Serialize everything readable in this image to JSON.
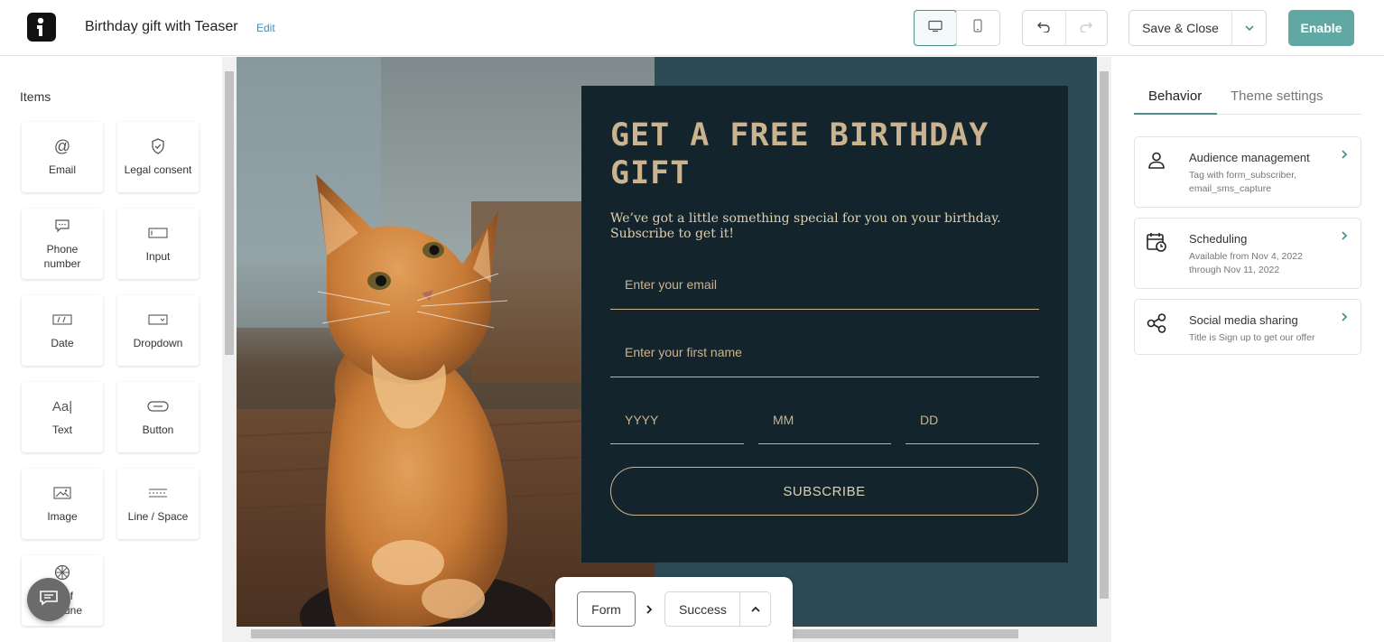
{
  "header": {
    "title": "Birthday gift with Teaser",
    "edit_label": "Edit",
    "save_label": "Save & Close",
    "enable_label": "Enable",
    "device_icons": [
      "desktop-icon",
      "mobile-icon"
    ],
    "history_icons": [
      "undo-icon",
      "redo-icon"
    ]
  },
  "left_panel": {
    "title": "Items",
    "items": [
      {
        "label": "Email",
        "icon": "at-icon"
      },
      {
        "label": "Legal consent",
        "icon": "shield-check-icon"
      },
      {
        "label": "Phone number",
        "icon": "chat-icon"
      },
      {
        "label": "Input",
        "icon": "input-icon"
      },
      {
        "label": "Date",
        "icon": "date-icon"
      },
      {
        "label": "Dropdown",
        "icon": "dropdown-icon"
      },
      {
        "label": "Text",
        "icon": "text-icon"
      },
      {
        "label": "Button",
        "icon": "button-icon"
      },
      {
        "label": "Image",
        "icon": "image-icon"
      },
      {
        "label": "Line / Space",
        "icon": "line-space-icon"
      },
      {
        "label_line1": "of",
        "label_line2": "une",
        "icon": "wheel-icon"
      }
    ]
  },
  "form": {
    "title": "GET A FREE BIRTHDAY GIFT",
    "subtitle": "We’ve got a little something special for you on your birthday. Subscribe to get it!",
    "email_placeholder": "Enter your email",
    "name_placeholder": "Enter your first name",
    "year_placeholder": "YYYY",
    "month_placeholder": "MM",
    "day_placeholder": "DD",
    "submit_label": "SUBSCRIBE"
  },
  "steps": {
    "form_label": "Form",
    "success_label": "Success"
  },
  "right_panel": {
    "tabs": [
      "Behavior",
      "Theme settings"
    ],
    "active_tab": "Behavior",
    "cards": [
      {
        "title": "Audience management",
        "desc_line1": "Tag with form_subscriber,",
        "desc_line2": "email_sms_capture",
        "icon": "person-icon"
      },
      {
        "title": "Scheduling",
        "desc_line1": "Available from Nov 4, 2022",
        "desc_line2": "through Nov 11, 2022",
        "icon": "calendar-clock-icon"
      },
      {
        "title": "Social media sharing",
        "desc_line1": "Title is Sign up to get our offer",
        "icon": "share-icon"
      }
    ]
  },
  "colors": {
    "accent": "#4d8f91",
    "enable_button": "#5fa8a3",
    "form_panel": "#14242c",
    "canvas_bg": "#2e4a55",
    "form_gold": "#cbb38f"
  }
}
